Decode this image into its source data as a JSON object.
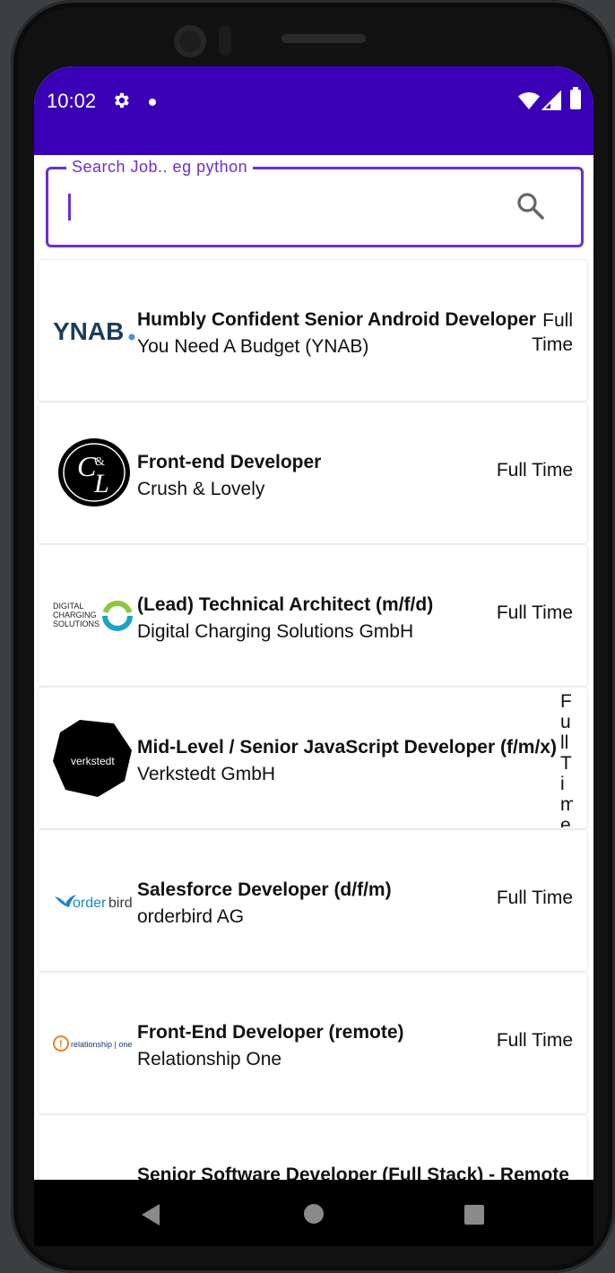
{
  "status_bar": {
    "time": "10:02",
    "icons": [
      "gear-icon",
      "notification-dot-icon",
      "wifi-icon",
      "signal-icon",
      "battery-icon"
    ],
    "color": "#3a00b5"
  },
  "search": {
    "label": "Search Job.. eg python",
    "value": "",
    "accent": "#6b2ed6"
  },
  "jobs": [
    {
      "title": "Humbly Confident Senior Android Developer",
      "company": "You Need A Budget (YNAB)",
      "type": "Full Time",
      "logo": "ynab-logo",
      "logo_text": "YNAB"
    },
    {
      "title": "Front-end Developer",
      "company": "Crush & Lovely",
      "type": "Full Time",
      "logo": "crush-lovely-logo",
      "logo_text": "C&L"
    },
    {
      "title": "(Lead) Technical Architect (m/f/d)",
      "company": "Digital Charging Solutions GmbH",
      "type": "Full Time",
      "logo": "digital-charging-logo",
      "logo_text": "DIGITAL CHARGING SOLUTIONS"
    },
    {
      "title": "Mid-Level / Senior JavaScript Developer (f/m/x)",
      "company": "Verkstedt GmbH",
      "type": "Full Time",
      "logo": "verkstedt-logo",
      "logo_text": "verkstedt"
    },
    {
      "title": "Salesforce Developer (d/f/m)",
      "company": "orderbird AG",
      "type": "Full Time",
      "logo": "orderbird-logo",
      "logo_text": "orderbird"
    },
    {
      "title": "Front-End Developer (remote)",
      "company": "Relationship One",
      "type": "Full Time",
      "logo": "relationship-one-logo",
      "logo_text": "relationship | one"
    },
    {
      "title": "Senior Software Developer (Full Stack) - Remote",
      "company": "",
      "type": "",
      "logo": "",
      "logo_text": ""
    }
  ],
  "nav": {
    "icons": [
      "back-icon",
      "home-icon",
      "recents-icon"
    ]
  }
}
